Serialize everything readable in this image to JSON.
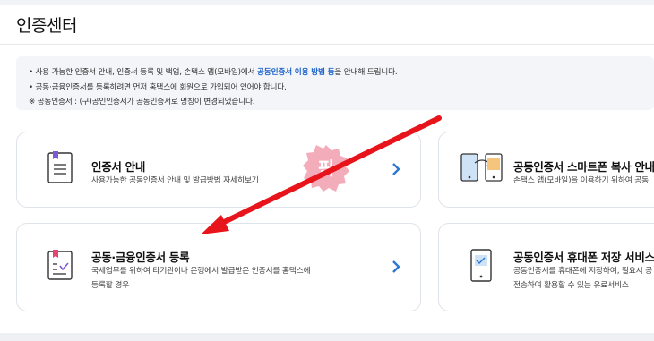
{
  "page": {
    "title": "인증센터"
  },
  "info": {
    "line1_pre": "• 사용 가능한 인증서 안내, 인증서 등록 및 백업, 손택스 앱(모바일)에서 ",
    "line1_highlight": "공동인증서 이용 방법 등",
    "line1_post": "을 안내해 드립니다.",
    "line2": "• 공동·금융인증서를 등록하려면 먼저 홈택스에 회원으로 가입되어 있어야 합니다.",
    "line3": "※ 공동인증서 : (구)공인인증서가 공동인증서로 명칭이 변경되었습니다."
  },
  "cards": [
    {
      "title": "인증서 안내",
      "desc1": "사용가능한 공동인증서 안내 및 발급방법 자세히보기",
      "desc2": ""
    },
    {
      "title": "공동인증서 스마트폰 복사 안내",
      "desc1": "손택스 앱(모바일)을 이용하기 위하여 공동",
      "desc2": ""
    },
    {
      "title": "공동·금융인증서 등록",
      "desc1": "국세업무를 위하여 타기관이나 은행에서 발급받은 인증서를 홈택스에",
      "desc2": "등록할 경우"
    },
    {
      "title": "공동인증서 휴대폰 저장 서비스",
      "desc1": "공동인증서를 휴대폰에 저장하여, 필요시 공",
      "desc2": "전송하여 활용할 수 있는 유료서비스"
    }
  ],
  "stamp": {
    "text": "픽"
  },
  "colors": {
    "accent": "#1e63c8",
    "arrow": "#e8141b",
    "stamp": "#f2a3b3",
    "chevron": "#2d78d2"
  }
}
